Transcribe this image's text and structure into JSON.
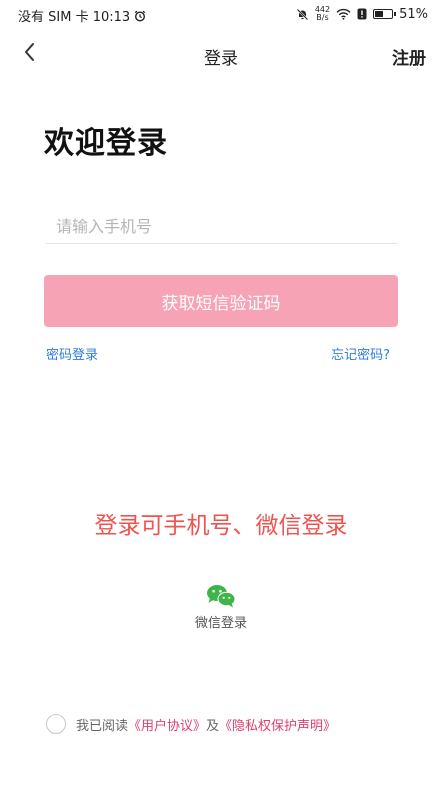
{
  "status_bar": {
    "left_text": "没有 SIM 卡 10:13",
    "net_speed_value": "442",
    "net_speed_unit": "B/s",
    "battery_text": "51%",
    "battery_level": 0.51
  },
  "nav": {
    "title": "登录",
    "register_label": "注册"
  },
  "welcome_title": "欢迎登录",
  "phone_field": {
    "placeholder": "请输入手机号",
    "value": ""
  },
  "sms_button_label": "获取短信验证码",
  "password_login_label": "密码登录",
  "forgot_password_label": "忘记密码?",
  "promo_text": "登录可手机号、微信登录",
  "wechat": {
    "label": "微信登录",
    "color": "#3fb549"
  },
  "agreement": {
    "prefix": "我已阅读",
    "user_agreement": "《用户协议》",
    "conjunction": "及",
    "privacy_policy": "《隐私权保护声明》"
  },
  "colors": {
    "accent_pink": "#f7a3b6",
    "link_blue": "#2d7be0",
    "promo_red": "#ef5350",
    "agreement_link": "#e03f6a"
  }
}
